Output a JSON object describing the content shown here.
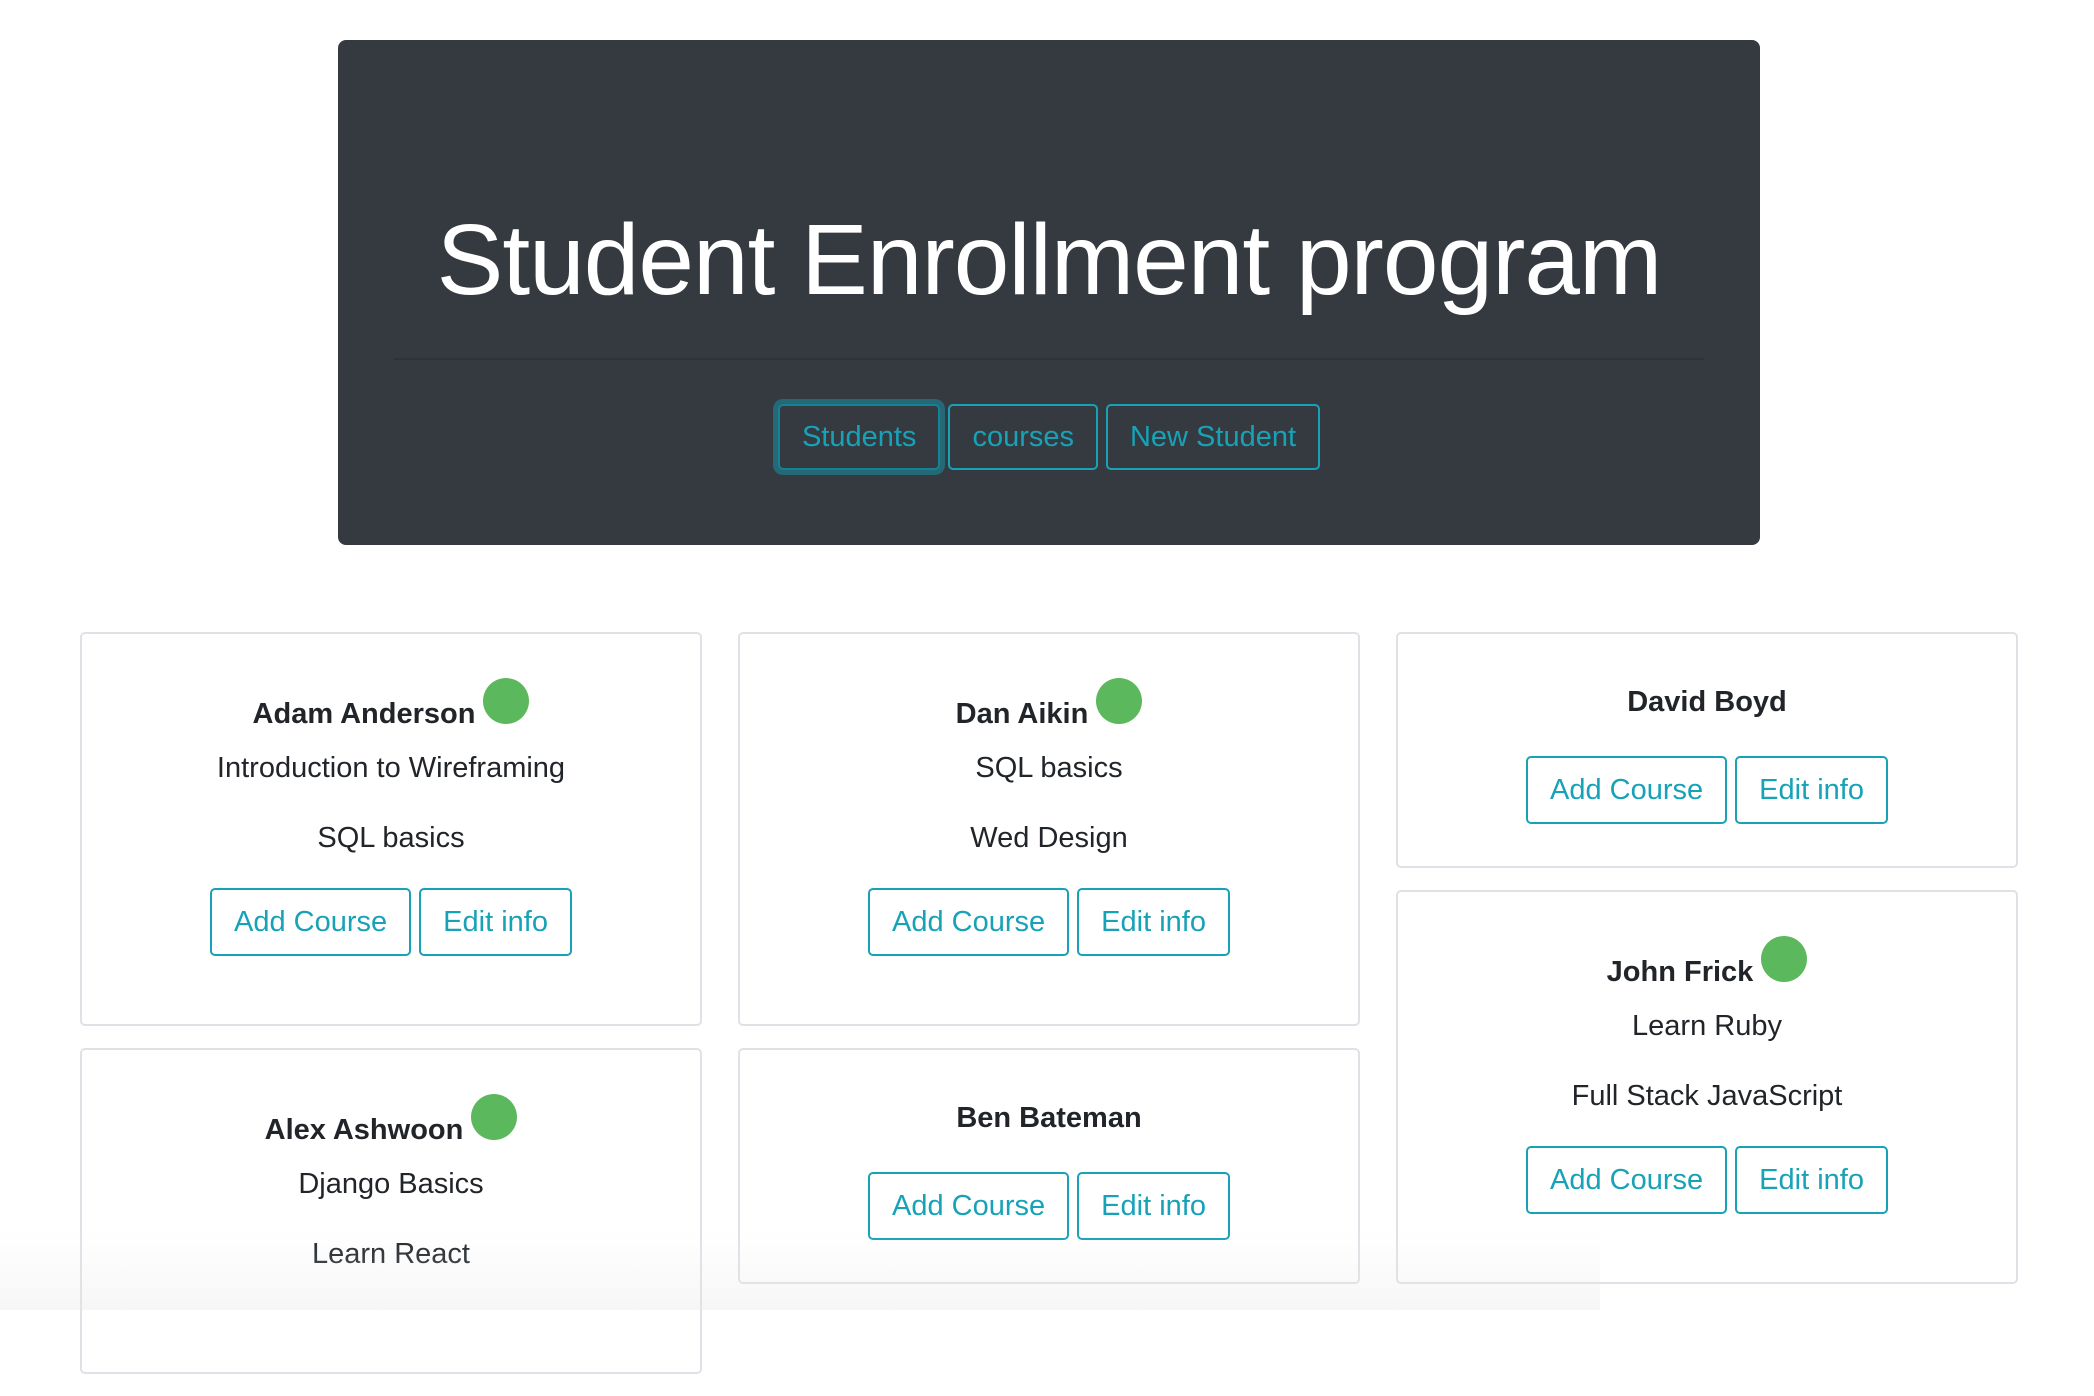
{
  "header": {
    "title": "Student Enrollment program",
    "nav": [
      "Students",
      "courses",
      "New Student"
    ]
  },
  "cards": {
    "adam": {
      "name": "Adam Anderson",
      "courses": [
        "Introduction to Wireframing",
        "SQL basics"
      ],
      "add_label": "Add Course",
      "edit_label": "Edit info"
    },
    "alex": {
      "name": "Alex Ashwoon",
      "courses": [
        "Django Basics",
        "Learn React"
      ]
    },
    "dan": {
      "name": "Dan Aikin",
      "courses": [
        "SQL basics",
        "Wed Design"
      ],
      "add_label": "Add Course",
      "edit_label": "Edit info"
    },
    "ben": {
      "name": "Ben Bateman",
      "add_label": "Add Course",
      "edit_label": "Edit info"
    },
    "david": {
      "name": "David Boyd",
      "add_label": "Add Course",
      "edit_label": "Edit info"
    },
    "john": {
      "name": "John Frick",
      "courses": [
        "Learn Ruby",
        "Full Stack JavaScript"
      ],
      "add_label": "Add Course",
      "edit_label": "Edit info"
    }
  },
  "colors": {
    "header_bg": "#343a40",
    "accent": "#17a2b8",
    "status_active": "#5cb85c"
  },
  "icons": {
    "status": "green-status-dot-icon"
  }
}
